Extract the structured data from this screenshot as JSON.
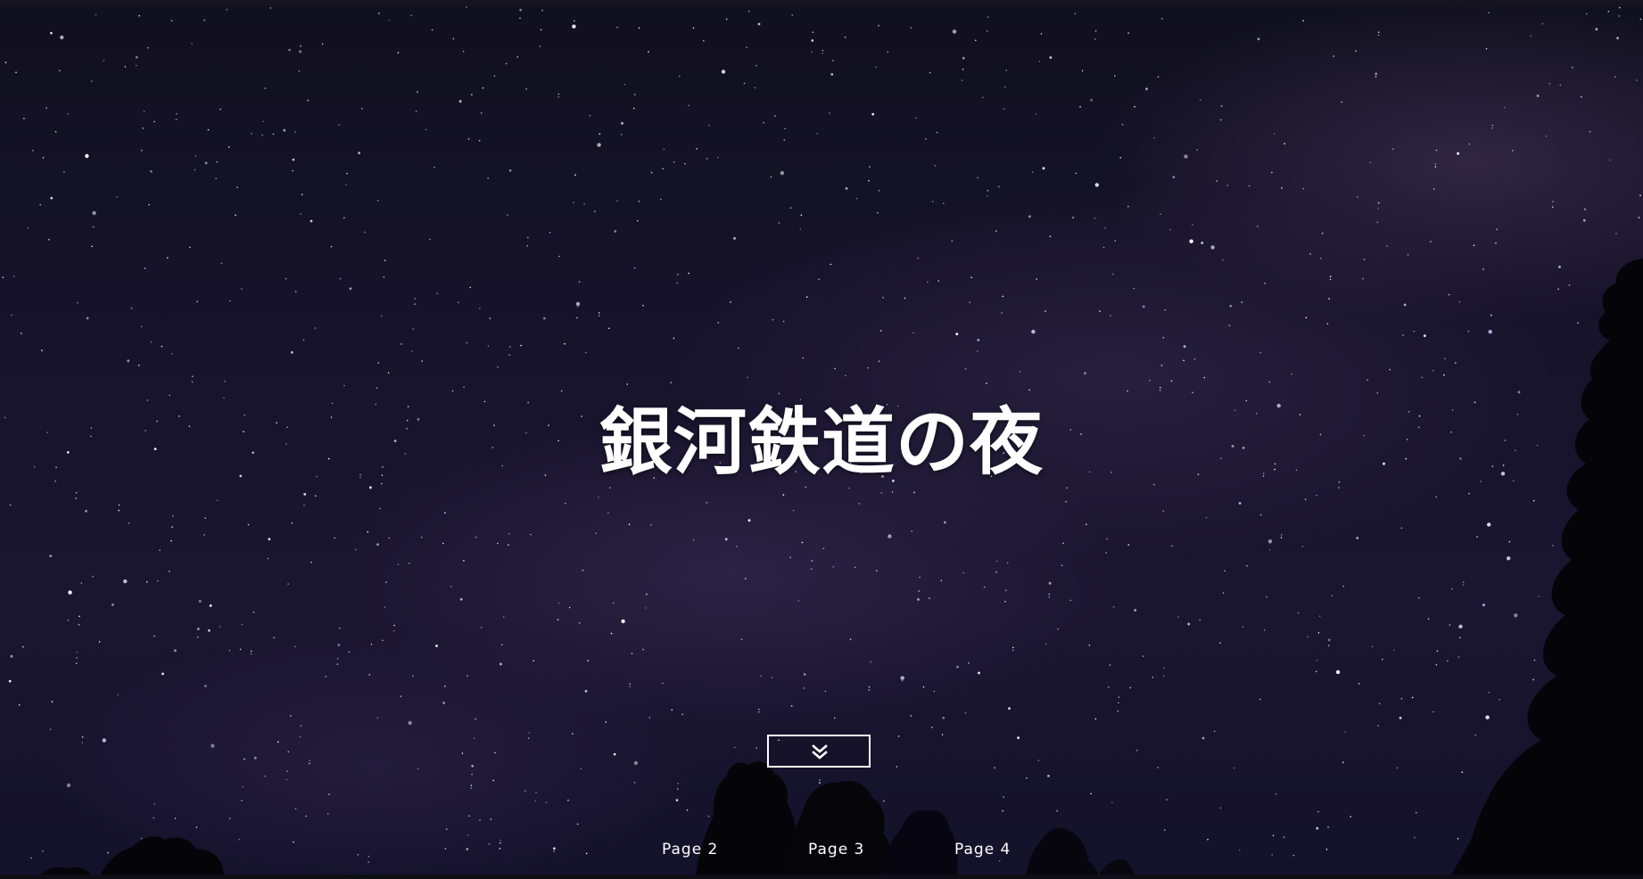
{
  "hero": {
    "title": "銀河鉄道の夜"
  },
  "scroll_button": {
    "icon": "double-chevron-down-icon"
  },
  "nav": {
    "items": [
      {
        "label": "Page 2"
      },
      {
        "label": "Page 3"
      },
      {
        "label": "Page 4"
      }
    ]
  },
  "colors": {
    "sky": "#17132b",
    "text": "#ffffff",
    "tree": "#050408"
  }
}
